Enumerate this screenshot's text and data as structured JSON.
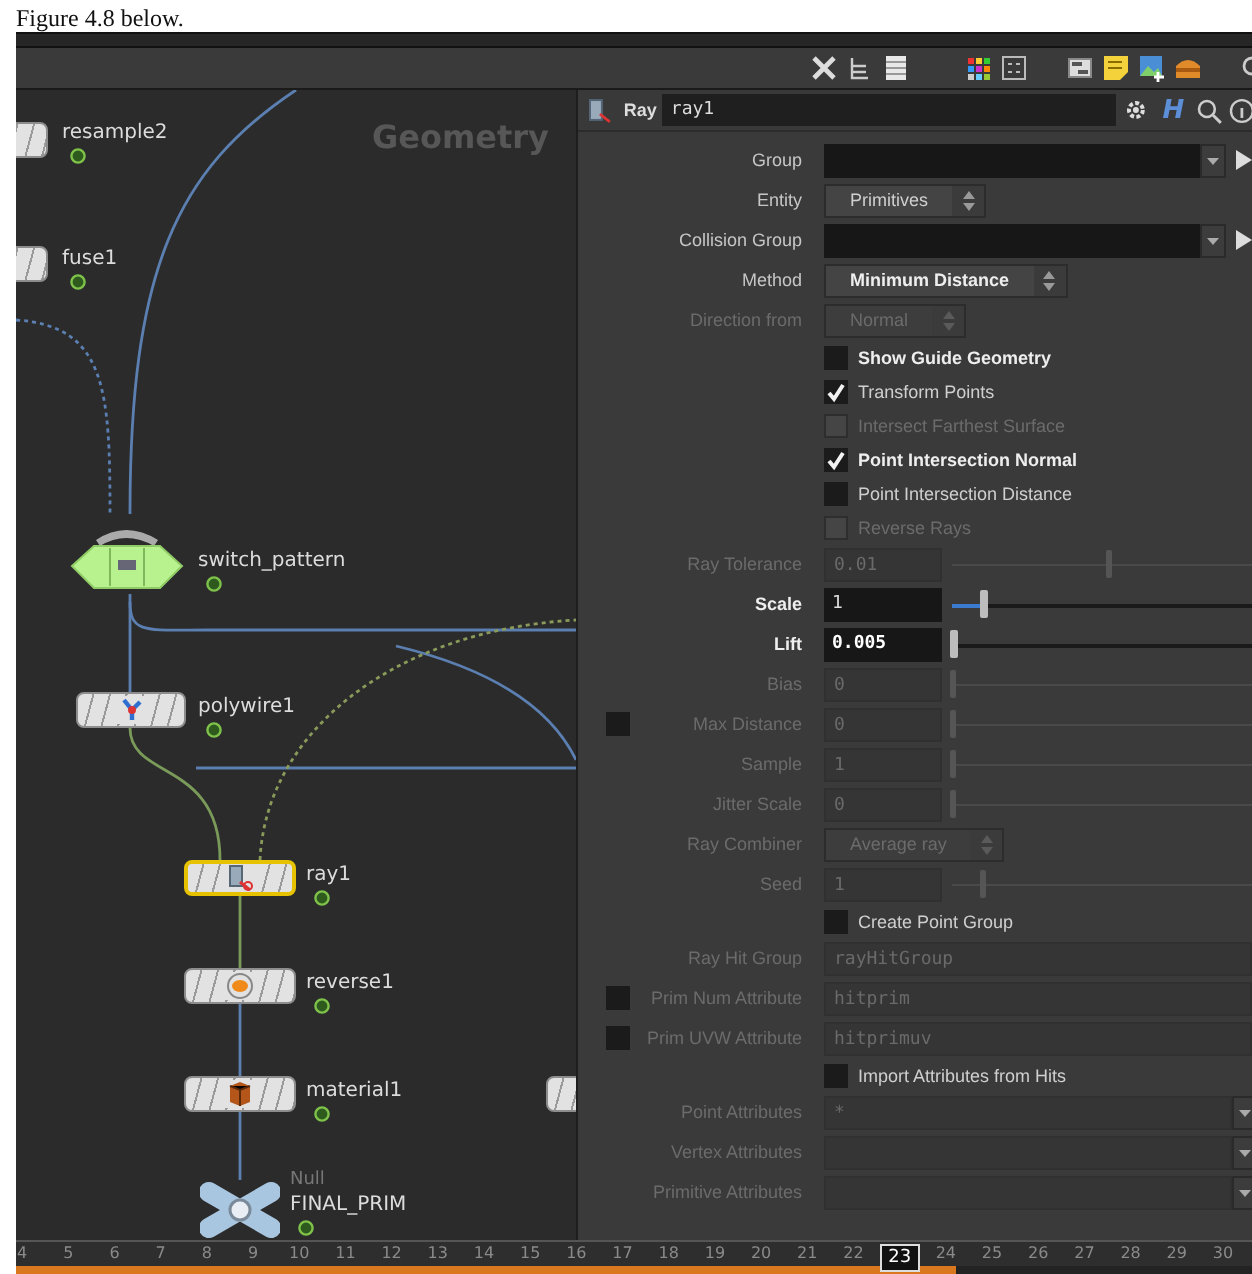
{
  "document": {
    "text": "Figure 4.8 below."
  },
  "network": {
    "context_label": "Geometry",
    "nodes": [
      {
        "name": "resample2",
        "kind": "sop",
        "selected": false
      },
      {
        "name": "fuse1",
        "kind": "sop",
        "selected": false
      },
      {
        "name": "switch_pattern",
        "kind": "switch",
        "selected": false
      },
      {
        "name": "polywire1",
        "kind": "sop",
        "selected": false
      },
      {
        "name": "ray1",
        "kind": "sop",
        "selected": true
      },
      {
        "name": "reverse1",
        "kind": "sop",
        "selected": false
      },
      {
        "name": "material1",
        "kind": "sop",
        "selected": false
      },
      {
        "kind": "sop",
        "selected": false
      },
      {
        "name": "FINAL_PRIM",
        "type_label": "Null",
        "kind": "null",
        "selected": false
      }
    ]
  },
  "parameters": {
    "type_label": "Ray",
    "node_name": "ray1",
    "help_button": "H",
    "params": [
      {
        "label": "Group",
        "kind": "group",
        "disabled": false,
        "modified": false
      },
      {
        "label": "Entity",
        "kind": "menu",
        "value": "Primitives",
        "disabled": false,
        "modified": false
      },
      {
        "label": "Collision Group",
        "kind": "group",
        "disabled": false,
        "modified": false
      },
      {
        "label": "Method",
        "kind": "menu",
        "value": "Minimum Distance",
        "disabled": false,
        "modified": true
      },
      {
        "label": "Direction from",
        "kind": "menu",
        "value": "Normal",
        "disabled": true,
        "modified": false
      },
      {
        "label": "Show Guide Geometry",
        "kind": "toggle",
        "checked": false,
        "disabled": false,
        "modified": true
      },
      {
        "label": "Transform Points",
        "kind": "toggle",
        "checked": true,
        "disabled": false,
        "modified": false
      },
      {
        "label": "Intersect Farthest Surface",
        "kind": "toggle",
        "checked": false,
        "disabled": true,
        "modified": false
      },
      {
        "label": "Point Intersection Normal",
        "kind": "toggle",
        "checked": true,
        "disabled": false,
        "modified": true
      },
      {
        "label": "Point Intersection Distance",
        "kind": "toggle",
        "checked": false,
        "disabled": false,
        "modified": false
      },
      {
        "label": "Reverse Rays",
        "kind": "toggle",
        "checked": false,
        "disabled": true,
        "modified": false
      },
      {
        "label": "Ray Tolerance",
        "kind": "slider",
        "value": "0.01",
        "level": 0.52,
        "disabled": true,
        "modified": false
      },
      {
        "label": "Scale",
        "kind": "slider",
        "value": "1",
        "level": 0.1,
        "disabled": false,
        "modified": true
      },
      {
        "label": "Lift",
        "kind": "slider",
        "value": "0.005",
        "level": 0,
        "disabled": false,
        "modified": true
      },
      {
        "label": "Bias",
        "kind": "slider",
        "value": "0",
        "level": 0,
        "disabled": true,
        "modified": false
      },
      {
        "label": "Max Distance",
        "kind": "slider",
        "value": "0",
        "level": 0,
        "checked": false,
        "disabled": true,
        "modified": false
      },
      {
        "label": "Sample",
        "kind": "slider",
        "value": "1",
        "level": 0,
        "disabled": true,
        "modified": false
      },
      {
        "label": "Jitter Scale",
        "kind": "slider",
        "value": "0",
        "level": 0,
        "disabled": true,
        "modified": false
      },
      {
        "label": "Ray Combiner",
        "kind": "menu",
        "value": "Average ray",
        "disabled": true,
        "modified": false
      },
      {
        "label": "Seed",
        "kind": "slider",
        "value": "1",
        "level": 0.1,
        "disabled": true,
        "modified": false
      },
      {
        "label": "Create Point Group",
        "kind": "toggle",
        "checked": false,
        "disabled": false,
        "modified": false
      },
      {
        "label": "Ray Hit Group",
        "kind": "text",
        "value": "rayHitGroup",
        "disabled": true,
        "modified": false
      },
      {
        "label": "Prim Num Attribute",
        "kind": "text",
        "value": "hitprim",
        "checked": false,
        "disabled": true,
        "modified": false
      },
      {
        "label": "Prim UVW Attribute",
        "kind": "text",
        "value": "hitprimuv",
        "checked": false,
        "disabled": true,
        "modified": false
      },
      {
        "label": "Import Attributes from Hits",
        "kind": "toggle",
        "checked": false,
        "disabled": false,
        "modified": false
      },
      {
        "label": "Point Attributes",
        "kind": "list",
        "value": "*",
        "disabled": true,
        "modified": false
      },
      {
        "label": "Vertex Attributes",
        "kind": "list",
        "disabled": true,
        "modified": false
      },
      {
        "label": "Primitive Attributes",
        "kind": "list",
        "disabled": true,
        "modified": false
      }
    ]
  },
  "timeline": {
    "level": 0.75,
    "frames": [
      {
        "label": "4",
        "selected": false
      },
      {
        "label": "5",
        "selected": false
      },
      {
        "label": "6",
        "selected": false
      },
      {
        "label": "7",
        "selected": false
      },
      {
        "label": "8",
        "selected": false
      },
      {
        "label": "9",
        "selected": false
      },
      {
        "label": "10",
        "selected": false
      },
      {
        "label": "11",
        "selected": false
      },
      {
        "label": "12",
        "selected": false
      },
      {
        "label": "13",
        "selected": false
      },
      {
        "label": "14",
        "selected": false
      },
      {
        "label": "15",
        "selected": false
      },
      {
        "label": "16",
        "selected": false
      },
      {
        "label": "17",
        "selected": false
      },
      {
        "label": "18",
        "selected": false
      },
      {
        "label": "19",
        "selected": false
      },
      {
        "label": "20",
        "selected": false
      },
      {
        "label": "21",
        "selected": false
      },
      {
        "label": "22",
        "selected": false
      },
      {
        "label": "23",
        "selected": true
      },
      {
        "label": "24",
        "selected": false
      },
      {
        "label": "25",
        "selected": false
      },
      {
        "label": "26",
        "selected": false
      },
      {
        "label": "27",
        "selected": false
      },
      {
        "label": "28",
        "selected": false
      },
      {
        "label": "29",
        "selected": false
      },
      {
        "label": "30",
        "selected": false
      }
    ]
  }
}
